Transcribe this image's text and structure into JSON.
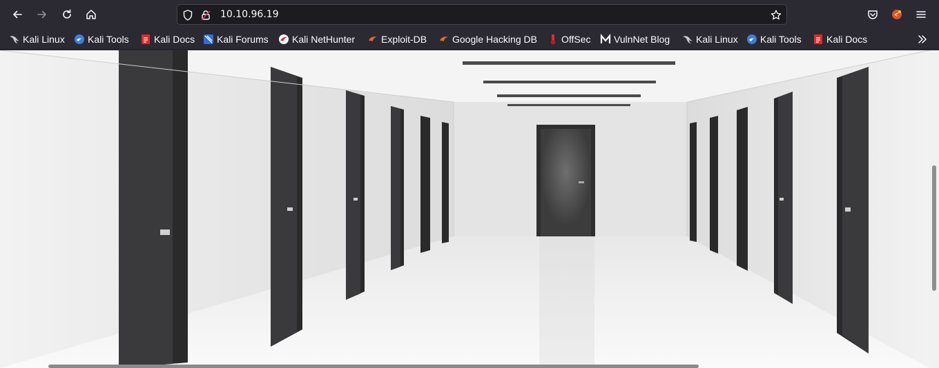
{
  "browser": {
    "url": "10.10.96.19",
    "toolbar": {
      "back": "back-icon",
      "forward": "forward-icon",
      "reload": "reload-icon",
      "home": "home-icon",
      "tracking": "shield-icon",
      "permissions": "lock-slash-icon",
      "bookmark_star": "star-icon",
      "pocket": "pocket-icon",
      "extension": "kali-extension-icon",
      "menu": "hamburger-menu-icon"
    },
    "bookmarks": [
      {
        "label": "Kali Linux",
        "icon": "kali-dragon-icon"
      },
      {
        "label": "Kali Tools",
        "icon": "kali-tools-icon"
      },
      {
        "label": "Kali Docs",
        "icon": "kali-docs-icon"
      },
      {
        "label": "Kali Forums",
        "icon": "kali-forums-icon"
      },
      {
        "label": "Kali NetHunter",
        "icon": "nethunter-icon"
      },
      {
        "label": "Exploit-DB",
        "icon": "exploit-db-icon"
      },
      {
        "label": "Google Hacking DB",
        "icon": "ghdb-icon"
      },
      {
        "label": "OffSec",
        "icon": "offsec-icon"
      },
      {
        "label": "VulnNet Blog",
        "icon": "vulnnet-icon"
      },
      {
        "label": "Kali Linux",
        "icon": "kali-dragon-icon"
      },
      {
        "label": "Kali Tools",
        "icon": "kali-tools-icon"
      },
      {
        "label": "Kali Docs",
        "icon": "kali-docs-icon"
      }
    ],
    "bookmarks_overflow": "chevron-double-right-icon"
  },
  "page": {
    "hero_image": "corridor-with-doors-image"
  },
  "colors": {
    "chrome_bg": "#2b2a33",
    "urlbar_bg": "#1c1b22",
    "text": "#fbfbfe",
    "door": "#3a3a3c",
    "wall": "#ececec"
  }
}
